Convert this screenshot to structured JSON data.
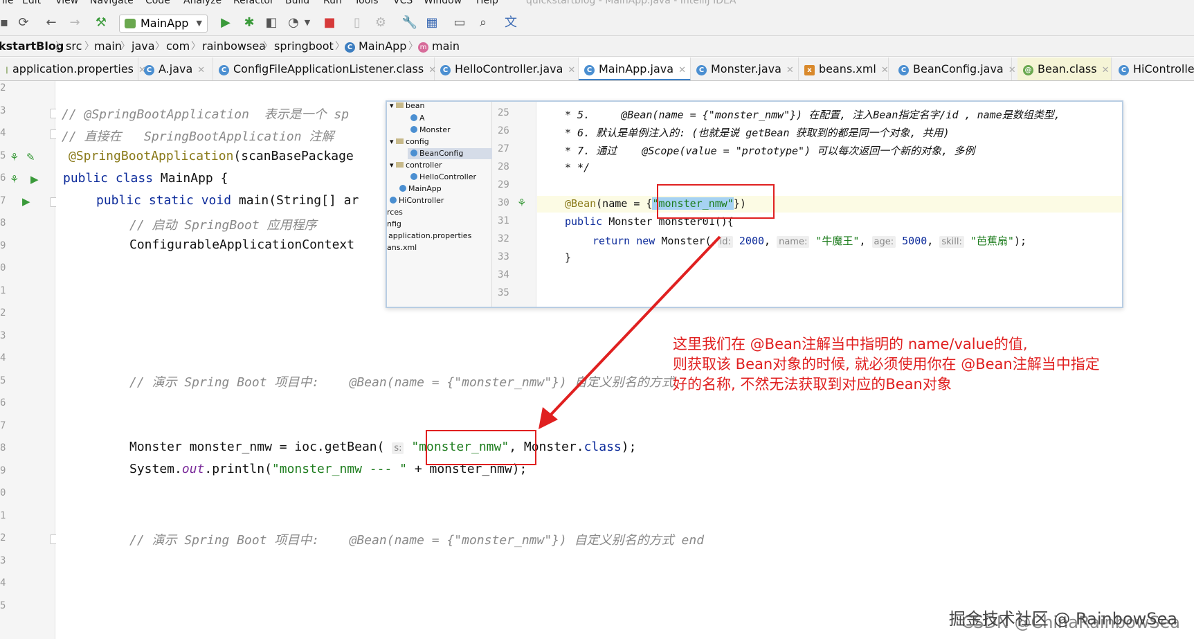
{
  "menu": {
    "items": [
      "File",
      "Edit",
      "View",
      "Navigate",
      "Code",
      "Analyze",
      "Refactor",
      "Build",
      "Run",
      "Tools",
      "VCS",
      "Window",
      "Help"
    ],
    "window_title": "quickstartblog - MainApp.java - IntelliJ IDEA"
  },
  "toolbar": {
    "run_config": "MainApp"
  },
  "breadcrumbs": [
    "kstartBlog",
    "src",
    "main",
    "java",
    "com",
    "rainbowsea",
    "springboot",
    "MainApp",
    "main"
  ],
  "tabs": [
    "application.properties",
    "A.java",
    "ConfigFileApplicationListener.class",
    "HelloController.java",
    "MainApp.java",
    "Monster.java",
    "beans.xml",
    "BeanConfig.java",
    "Bean.class",
    "HiController"
  ],
  "gutter_lines": [
    "2",
    "3",
    "4",
    "5",
    "6",
    "7",
    "8",
    "9",
    "0",
    "1",
    "2",
    "3",
    "4",
    "5",
    "6",
    "7",
    "8",
    "9",
    "0",
    "1",
    "2",
    "3",
    "4",
    "5"
  ],
  "editor": {
    "l1": "// @SpringBootApplication  表示是一个 sp",
    "l2": "// 直接在   SpringBootApplication 注解",
    "l3_anno": "@SpringBootApplication",
    "l3_rest": "(scanBasePackage",
    "l4_kw": "public class",
    "l4_rest": " MainApp {",
    "l5_kw": "public static void",
    "l5_rest": " main(String[] ar",
    "l6": "// 启动 SpringBoot 应用程序",
    "l7": "ConfigurableApplicationContext",
    "l8_a": "// 演示 Spring Boot 项目中:    @Bean(name = {\"monster_",
    "l8_b": "nmw\"}) 自定义别名的方式",
    "l9_a": "Monster monster_nmw = ioc.getBean(",
    "l9_hint": "s:",
    "l9_str": "\"monster_nmw\"",
    "l9_b": ", Monster.",
    "l9_kw": "class",
    "l9_c": ");",
    "l10_a": "System.",
    "l10_fld": "out",
    "l10_b": ".println(",
    "l10_str": "\"monster_nmw --- \"",
    "l10_c": " + monster_nmw);",
    "l11": "// 演示 Spring Boot 项目中:    @Bean(name = {\"monster_nmw\"}) 自定义别名的方式 end"
  },
  "popup": {
    "tree": [
      "bean",
      "A",
      "Monster",
      "config",
      "BeanConfig",
      "controller",
      "HelloController",
      "MainApp",
      "HiController",
      "rces",
      "nfig",
      "application.properties",
      "ans.xml"
    ],
    "line_numbers": [
      "25",
      "26",
      "27",
      "28",
      "29",
      "30",
      "31",
      "32",
      "33",
      "34",
      "35"
    ],
    "c25": "* 5.     @Bean(name = {\"monster_nmw\"}) 在配置, 注入Bean指定名字/id , name是数组类型,",
    "c26": "* 6. 默认是单例注入的: (也就是说 getBean 获取到的都是同一个对象, 共用)",
    "c27": "* 7. 通过    @Scope(value = \"prototype\") 可以每次返回一个新的对象, 多例",
    "c28": "* */",
    "c30_anno": "@Bean",
    "c30_a": "(name = {",
    "c30_sel": "\"monster_nmw\"",
    "c30_b": "})",
    "c31_kw": "public",
    "c31_a": " Monster monster01(){",
    "c32_kw": "return new",
    "c32_a": " Monster(",
    "c32_h1": "id:",
    "c32_v1": " 2000",
    "c32_h2": "name:",
    "c32_v2": " \"牛魔王\"",
    "c32_h3": "age:",
    "c32_v3": " 5000",
    "c32_h4": "skill:",
    "c32_v4": " \"芭蕉扇\"",
    "c32_end": ");",
    "c33": "}"
  },
  "annotation": {
    "line1": "这里我们在 @Bean注解当中指明的 name/value的值,",
    "line2": "则获取该 Bean对象的时候, 就必须使用你在 @Bean注解当中指定",
    "line3": "好的名称, 不然无法获取到对应的Bean对象"
  },
  "watermark": "掘金技术社区 @ RainbowSea",
  "watermark_under": "CSDN @ChinaRainbowSea",
  "colors": {
    "accent": "#4083c9",
    "annotation_red": "#e02020",
    "keyword": "#0b2a9a",
    "string": "#1e7d1e",
    "comment": "#8a8a8a"
  }
}
